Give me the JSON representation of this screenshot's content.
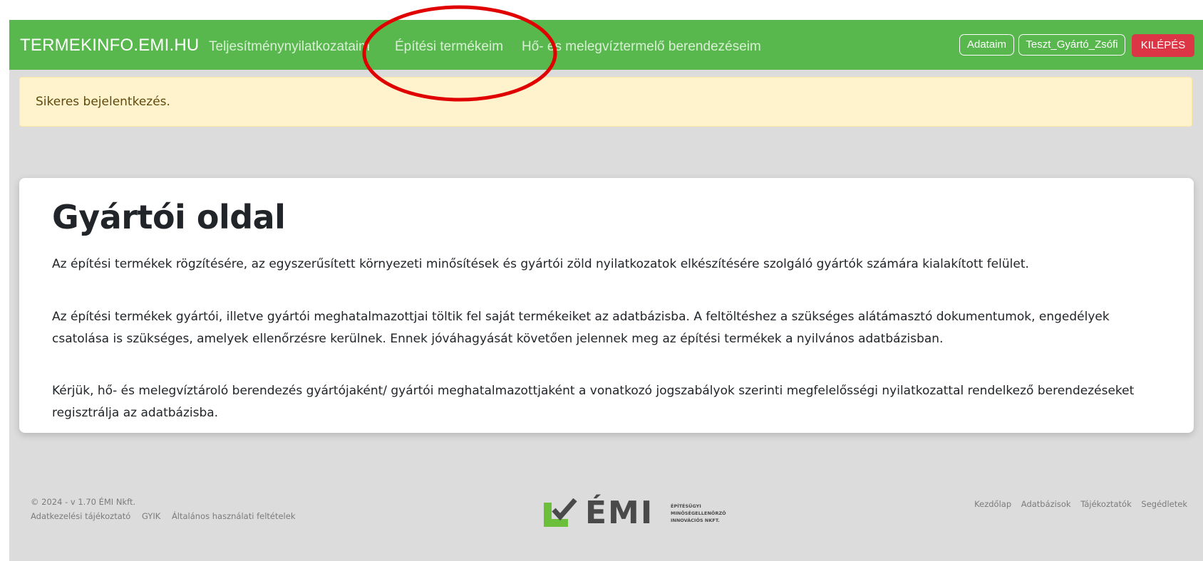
{
  "navbar": {
    "brand": "TERMEKINFO.EMI.HU",
    "links": [
      "Teljesítménynyilatkozataim",
      "Építési termékeim",
      "Hő- és melegvíztermelő berendezéseim"
    ],
    "adataim": "Adataim",
    "user": "Teszt_Gyártó_Zsófi",
    "logout": "KILÉPÉS"
  },
  "alert": {
    "message": "Sikeres bejelentkezés."
  },
  "card": {
    "title": "Gyártói oldal",
    "paragraphs": [
      "Az építési termékek rögzítésére, az egyszerűsített környezeti minősítések és gyártói zöld nyilatkozatok elkészítésére szolgáló gyártók számára kialakított felület.",
      "Az építési termékek gyártói, illetve gyártói meghatalmazottjai töltik fel saját termékeiket az adatbázisba. A feltöltéshez a szükséges alátámasztó dokumentumok, engedélyek csatolása is szükséges, amelyek ellenőrzésre kerülnek. Ennek jóváhagyását követően jelennek meg az építési termékek a nyilvános adatbázisban.",
      "Kérjük, hő- és melegvíztároló berendezés gyártójaként/ gyártói meghatalmazottjaként a vonatkozó jogszabályok szerinti megfelelősségi nyilatkozattal rendelkező berendezéseket regisztrálja az adatbázisba."
    ]
  },
  "footer": {
    "copyright": "© 2024 - v 1.70 ÉMI Nkft.",
    "left_links": [
      "Adatkezelési tájékoztató",
      "GYIK",
      "Általános használati feltételek"
    ],
    "logo_text": "ÉMI",
    "logo_sub": [
      "ÉPÍTÉSÜGYI",
      "MINŐSÉGELLENŐRZŐ",
      "INNOVÁCIÓS NKFT."
    ],
    "right_links": [
      "Kezdőlap",
      "Adatbázisok",
      "Tájékoztatók",
      "Segédletek"
    ]
  },
  "colors": {
    "navbar_bg": "#58b84e",
    "alert_bg": "#fff3cd",
    "logout_bg": "#dc3545",
    "annotation_circle": "#e00000",
    "logo_green": "#6bbf3b"
  }
}
